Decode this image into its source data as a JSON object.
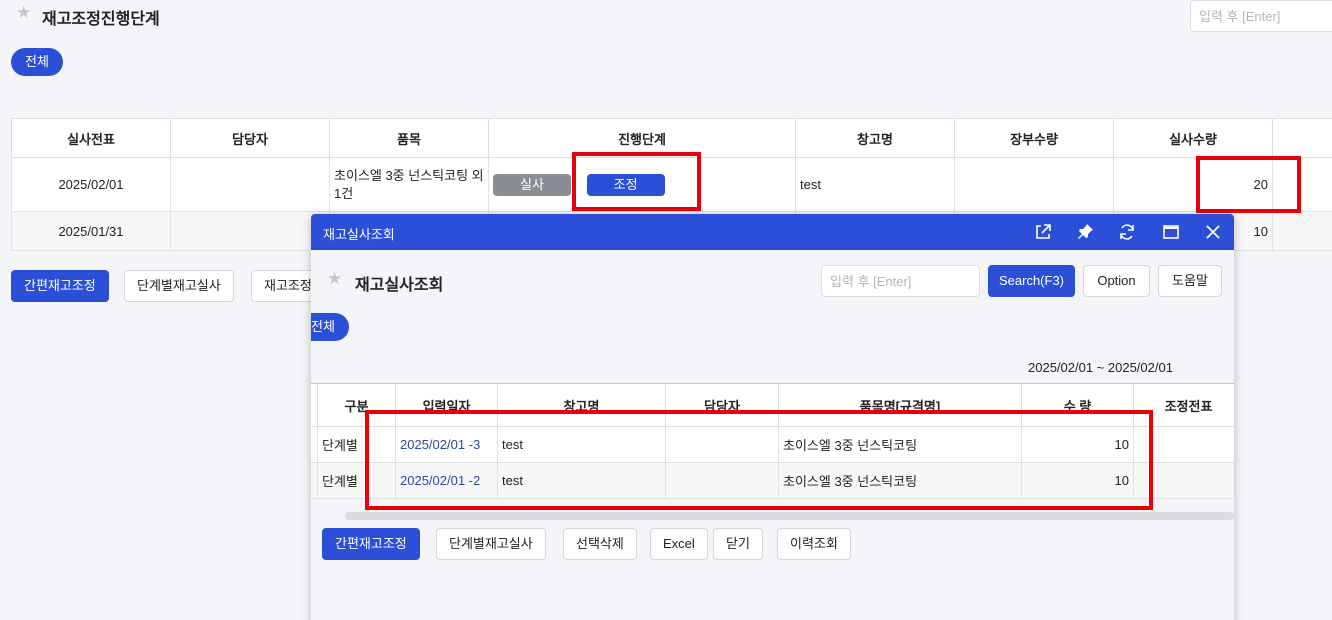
{
  "page": {
    "title": "재고조정진행단계",
    "search_placeholder": "입력 후 [Enter]",
    "filter_all": "전체"
  },
  "main_grid": {
    "headers": [
      "실사전표",
      "담당자",
      "품목",
      "진행단계",
      "창고명",
      "장부수량",
      "실사수량"
    ],
    "rows": [
      {
        "doc": "2025/02/01",
        "manager": "",
        "item": "초이스엘 3중 넌스틱코팅 외 1건",
        "stage_done": "실사",
        "stage_current": "조정",
        "warehouse": "test",
        "book_qty": "",
        "actual_qty": "20"
      },
      {
        "doc": "2025/01/31",
        "manager": "",
        "item": "",
        "stage_done": "",
        "stage_current": "",
        "warehouse": "",
        "book_qty": "",
        "actual_qty": "10"
      }
    ]
  },
  "main_buttons": {
    "simple_adjust": "간편재고조정",
    "step_inspect": "단계별재고실사",
    "adjust_partial": "재고조정"
  },
  "modal": {
    "window_title": "재고실사조회",
    "body_title": "재고실사조회",
    "search_placeholder": "입력 후 [Enter]",
    "search_button": "Search(F3)",
    "option_button": "Option",
    "help_button": "도움말",
    "filter_all": "전체",
    "date_range": "2025/02/01 ~ 2025/02/01",
    "headers": [
      "구분",
      "입력일자",
      "창고명",
      "담당자",
      "품목명[규격명]",
      "수 량",
      "조정전표"
    ],
    "rows": [
      {
        "type": "단계별",
        "date": "2025/02/01 -3",
        "warehouse": "test",
        "manager": "",
        "item": "초이스엘 3중 넌스틱코팅",
        "qty": "10",
        "adj_doc": ""
      },
      {
        "type": "단계별",
        "date": "2025/02/01 -2",
        "warehouse": "test",
        "manager": "",
        "item": "초이스엘 3중 넌스틱코팅",
        "qty": "10",
        "adj_doc": ""
      }
    ],
    "buttons": {
      "simple_adjust": "간편재고조정",
      "step_inspect": "단계별재고실사",
      "delete_selected": "선택삭제",
      "excel": "Excel",
      "close": "닫기",
      "history": "이력조회"
    }
  },
  "colors": {
    "primary": "#2b4fd6",
    "highlight": "#e8000b",
    "stage_done": "#8a8d93"
  }
}
